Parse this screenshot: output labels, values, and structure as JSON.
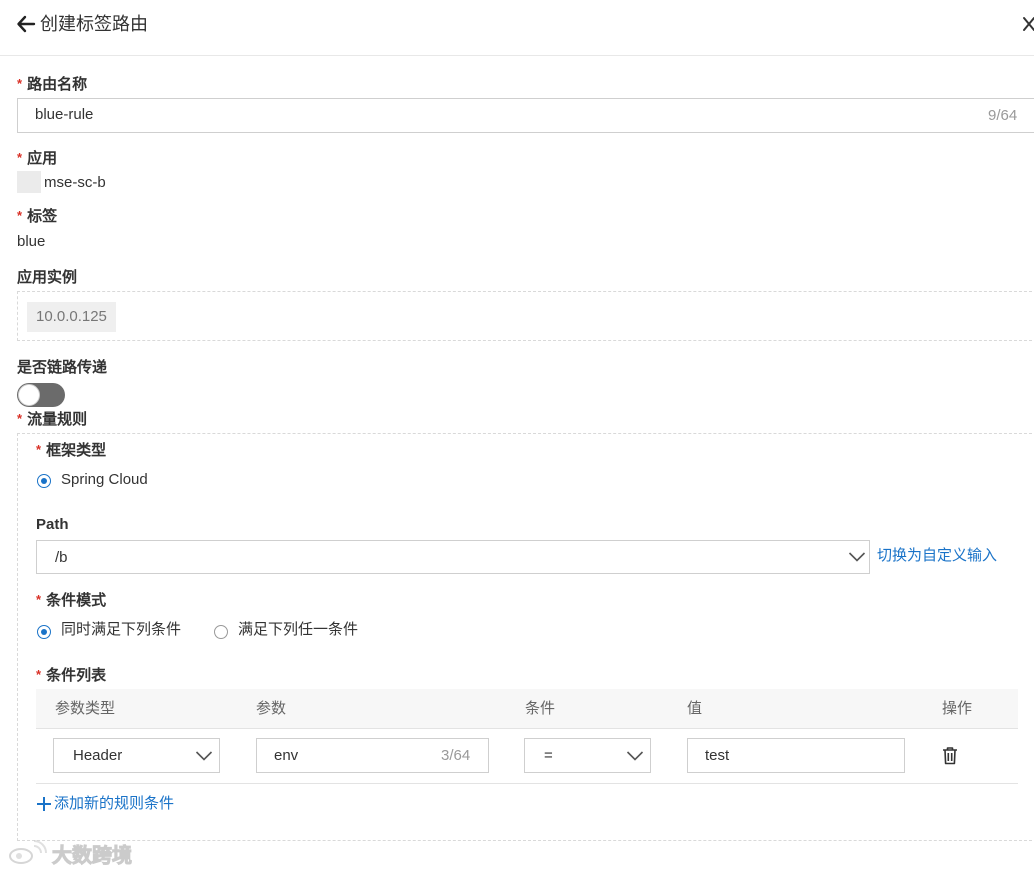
{
  "header": {
    "title": "创建标签路由"
  },
  "form": {
    "route_name": {
      "label": "路由名称",
      "value": "blue-rule",
      "counter": "9/64"
    },
    "app": {
      "label": "应用",
      "value": "mse-sc-b"
    },
    "tag": {
      "label": "标签",
      "value": "blue"
    },
    "instances": {
      "label": "应用实例",
      "items": [
        "10.0.0.125"
      ]
    },
    "chain": {
      "label": "是否链路传递",
      "enabled": false
    },
    "traffic": {
      "label": "流量规则",
      "framework": {
        "label": "框架类型",
        "option": "Spring Cloud"
      },
      "path": {
        "label": "Path",
        "value": "/b",
        "switch_link": "切换为自定义输入"
      },
      "condition_mode": {
        "label": "条件模式",
        "options": [
          "同时满足下列条件",
          "满足下列任一条件"
        ],
        "selected": "同时满足下列条件"
      },
      "condition_list": {
        "label": "条件列表",
        "columns": [
          "参数类型",
          "参数",
          "条件",
          "值",
          "操作"
        ],
        "rows": [
          {
            "param_type": "Header",
            "param": "env",
            "param_counter": "3/64",
            "operator": "=",
            "value": "test"
          }
        ],
        "add_link": "添加新的规则条件"
      }
    }
  },
  "watermark": {
    "text": "大数跨境"
  },
  "colors": {
    "accent": "#1a73c8",
    "required": "#d93026",
    "toggle_off": "#6b6b6b"
  },
  "icons": [
    "arrow-left-icon",
    "close-icon",
    "chevron-down-icon",
    "trash-icon",
    "plus-icon",
    "weibo-logo-icon"
  ]
}
